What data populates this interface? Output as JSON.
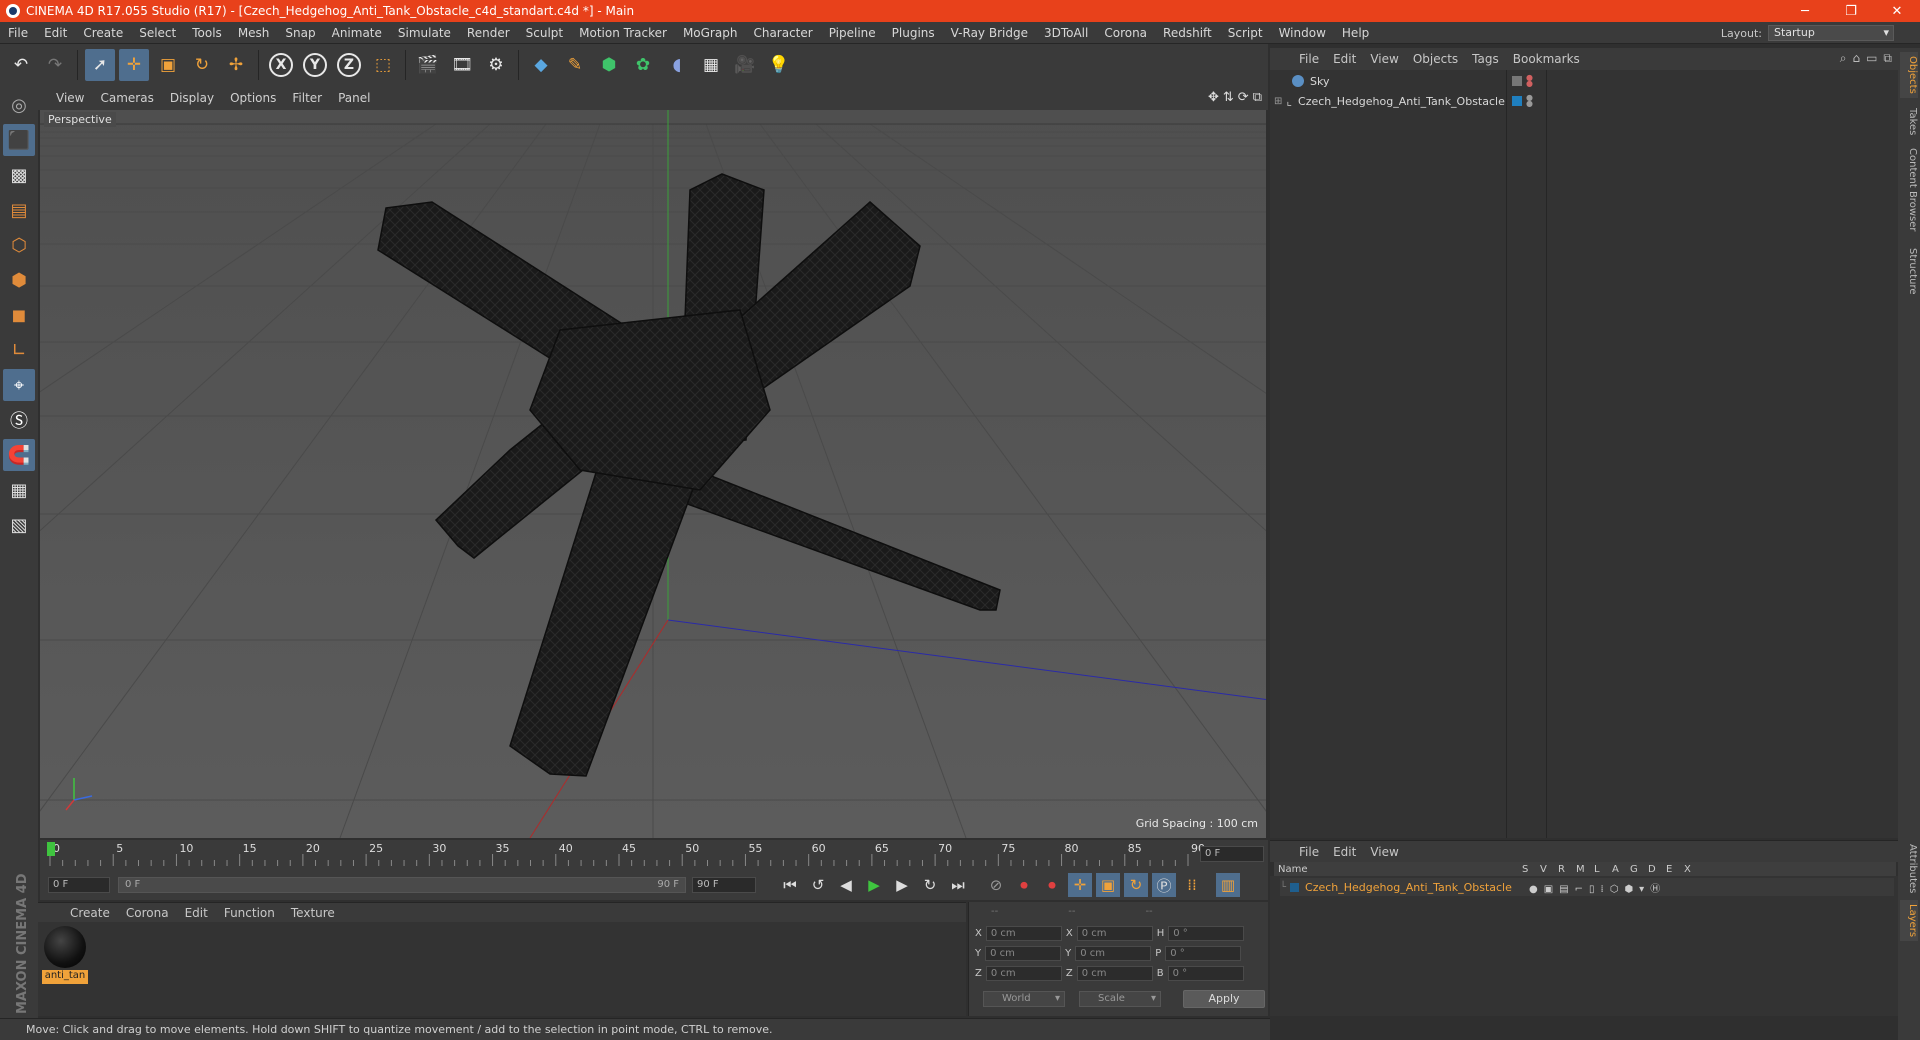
{
  "window": {
    "title": "CINEMA 4D R17.055 Studio (R17) - [Czech_Hedgehog_Anti_Tank_Obstacle_c4d_standart.c4d *] - Main",
    "buttons": [
      "─",
      "❐",
      "✕"
    ]
  },
  "menubar": {
    "items": [
      "File",
      "Edit",
      "Create",
      "Select",
      "Tools",
      "Mesh",
      "Snap",
      "Animate",
      "Simulate",
      "Render",
      "Sculpt",
      "Motion Tracker",
      "MoGraph",
      "Character",
      "Pipeline",
      "Plugins",
      "V-Ray Bridge",
      "3DToAll",
      "Corona",
      "Redshift",
      "Script",
      "Window",
      "Help"
    ],
    "layout_label": "Layout:",
    "layout_value": "Startup"
  },
  "toolbar": {
    "icons": [
      "undo-icon",
      "redo-icon",
      "select-arrow-icon",
      "move-icon",
      "scale-icon",
      "rotate-icon",
      "live-move-icon",
      "x-axis-icon",
      "y-axis-icon",
      "z-axis-icon",
      "coord-system-icon",
      "render-view-icon",
      "render-picture-viewer-icon",
      "edit-render-settings-icon",
      "cube-icon",
      "pen-spline-icon",
      "subdivision-icon",
      "array-icon",
      "deformer-icon",
      "floor-icon",
      "camera-icon",
      "light-icon"
    ],
    "axis_labels": [
      "X",
      "Y",
      "Z"
    ]
  },
  "viewport": {
    "menu": [
      "View",
      "Cameras",
      "Display",
      "Options",
      "Filter",
      "Panel"
    ],
    "label": "Perspective",
    "grid_spacing": "Grid Spacing : 100 cm"
  },
  "timeline": {
    "ticks": [
      "0",
      "5",
      "10",
      "15",
      "20",
      "25",
      "30",
      "35",
      "40",
      "45",
      "50",
      "55",
      "60",
      "65",
      "70",
      "75",
      "80",
      "85",
      "90"
    ],
    "current_frame": "0 F",
    "start_field": "0 F",
    "range_start": "0 F",
    "range_end": "90 F",
    "end_field": "90 F"
  },
  "materials": {
    "menu": [
      "Create",
      "Corona",
      "Edit",
      "Function",
      "Texture"
    ],
    "items": [
      {
        "name": "anti_tan"
      }
    ]
  },
  "coords": {
    "headers": [
      "--",
      "--",
      "--"
    ],
    "rows": [
      {
        "a": "X",
        "av": "0 cm",
        "b": "X",
        "bv": "0 cm",
        "c": "H",
        "cv": "0 °"
      },
      {
        "a": "Y",
        "av": "0 cm",
        "b": "Y",
        "bv": "0 cm",
        "c": "P",
        "cv": "0 °"
      },
      {
        "a": "Z",
        "av": "0 cm",
        "b": "Z",
        "bv": "0 cm",
        "c": "B",
        "cv": "0 °"
      }
    ],
    "world": "World",
    "scale": "Scale",
    "apply": "Apply"
  },
  "status": {
    "text": "Move: Click and drag to move elements. Hold down SHIFT to quantize movement / add to the selection in point mode, CTRL to remove."
  },
  "brand": "MAXON CINEMA 4D",
  "objects": {
    "menu": [
      "File",
      "Edit",
      "View",
      "Objects",
      "Tags",
      "Bookmarks"
    ],
    "items": [
      {
        "name": "Sky",
        "color": "#5a8fc4"
      },
      {
        "name": "Czech_Hedgehog_Anti_Tank_Obstacle",
        "color": "#1f7fbf"
      }
    ]
  },
  "layers": {
    "menu": [
      "File",
      "Edit",
      "View"
    ],
    "headers": [
      "Name",
      "S",
      "V",
      "R",
      "M",
      "L",
      "A",
      "G",
      "D",
      "E",
      "X"
    ],
    "items": [
      {
        "name": "Czech_Hedgehog_Anti_Tank_Obstacle",
        "color": "#f0a23a"
      }
    ]
  },
  "right_tabs": [
    "Objects",
    "Takes",
    "Content Browser",
    "Structure",
    "Attributes",
    "Layers"
  ],
  "colors": {
    "title_bar": "#e8411b",
    "accent_orange": "#f0a23a",
    "highlight_blue": "#4f6e8e"
  }
}
